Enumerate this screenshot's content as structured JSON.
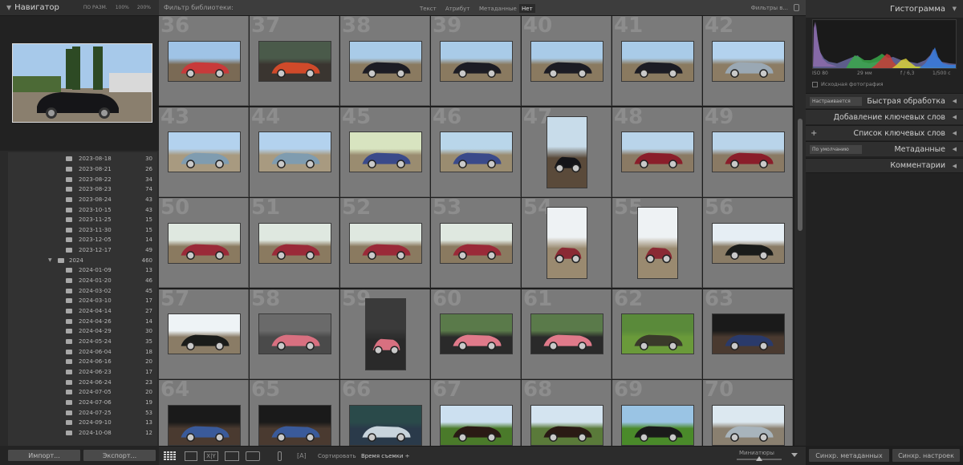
{
  "navigator": {
    "title": "Навигатор",
    "zoom_options": [
      "ПО РАЗМ.",
      "100%",
      "200%"
    ]
  },
  "folders": [
    {
      "name": "2023-08-18",
      "count": "30"
    },
    {
      "name": "2023-08-21",
      "count": "26"
    },
    {
      "name": "2023-08-22",
      "count": "34"
    },
    {
      "name": "2023-08-23",
      "count": "74"
    },
    {
      "name": "2023-08-24",
      "count": "43"
    },
    {
      "name": "2023-10-15",
      "count": "43"
    },
    {
      "name": "2023-11-25",
      "count": "15"
    },
    {
      "name": "2023-11-30",
      "count": "15"
    },
    {
      "name": "2023-12-05",
      "count": "14"
    },
    {
      "name": "2023-12-17",
      "count": "49"
    },
    {
      "name": "2024",
      "count": "460",
      "year": true
    },
    {
      "name": "2024-01-09",
      "count": "13"
    },
    {
      "name": "2024-01-20",
      "count": "46"
    },
    {
      "name": "2024-03-02",
      "count": "45"
    },
    {
      "name": "2024-03-10",
      "count": "17"
    },
    {
      "name": "2024-04-14",
      "count": "27"
    },
    {
      "name": "2024-04-26",
      "count": "14"
    },
    {
      "name": "2024-04-29",
      "count": "30"
    },
    {
      "name": "2024-05-24",
      "count": "35"
    },
    {
      "name": "2024-06-04",
      "count": "18"
    },
    {
      "name": "2024-06-16",
      "count": "20"
    },
    {
      "name": "2024-06-23",
      "count": "17"
    },
    {
      "name": "2024-06-24",
      "count": "23"
    },
    {
      "name": "2024-07-05",
      "count": "20"
    },
    {
      "name": "2024-07-06",
      "count": "19"
    },
    {
      "name": "2024-07-25",
      "count": "53"
    },
    {
      "name": "2024-09-10",
      "count": "13"
    },
    {
      "name": "2024-10-08",
      "count": "12"
    }
  ],
  "left_buttons": {
    "import": "Импорт...",
    "export": "Экспорт..."
  },
  "filter_bar": {
    "title": "Фильтр библиотеки:",
    "tabs": [
      "Текст",
      "Атрибут",
      "Метаданные",
      "Нет"
    ],
    "selected_tab": "Нет",
    "filters_label": "Фильтры в..."
  },
  "grid": {
    "numbers": [
      36,
      37,
      38,
      39,
      40,
      41,
      42,
      43,
      44,
      45,
      46,
      47,
      48,
      49,
      50,
      51,
      52,
      53,
      54,
      55,
      56,
      57,
      58,
      59,
      60,
      61,
      62,
      63,
      64,
      65,
      66,
      67,
      68,
      69,
      70
    ],
    "photos": [
      {
        "orient": "l",
        "color": "#c83a3a",
        "sky": "#9fc3e6",
        "ground": "#7a6a55"
      },
      {
        "orient": "l",
        "color": "#d04a2a",
        "sky": "#4a5a4a",
        "ground": "#3a3530"
      },
      {
        "orient": "l",
        "color": "#1c1c24",
        "sky": "#a9cbe8",
        "ground": "#8a7a60"
      },
      {
        "orient": "l",
        "color": "#1c1c24",
        "sky": "#a9cbe8",
        "ground": "#8a7a60"
      },
      {
        "orient": "l",
        "color": "#1c1c24",
        "sky": "#a9cbe8",
        "ground": "#8a7a60"
      },
      {
        "orient": "l",
        "color": "#1c1c24",
        "sky": "#a9cbe8",
        "ground": "#8a7a60"
      },
      {
        "orient": "l",
        "color": "#9aa8b4",
        "sky": "#b3d2ee",
        "ground": "#8c7c64"
      },
      {
        "orient": "l",
        "color": "#7f9cb0",
        "sky": "#b3d2ee",
        "ground": "#a89a80"
      },
      {
        "orient": "l",
        "color": "#7f9cb0",
        "sky": "#b3d2ee",
        "ground": "#a89a80"
      },
      {
        "orient": "l",
        "color": "#3a4a8a",
        "sky": "#d8e4c0",
        "ground": "#9a8c70"
      },
      {
        "orient": "l",
        "color": "#3a4a8a",
        "sky": "#b9d6ea",
        "ground": "#9a8c70"
      },
      {
        "orient": "p",
        "color": "#141418",
        "sky": "#c8dcea",
        "ground": "#5a4a3a"
      },
      {
        "orient": "l",
        "color": "#8a1e2a",
        "sky": "#b9d4ea",
        "ground": "#8a7a64"
      },
      {
        "orient": "l",
        "color": "#8a1e2a",
        "sky": "#b9d4ea",
        "ground": "#8a7a64"
      },
      {
        "orient": "l",
        "color": "#9a2a38",
        "sky": "#dfe8e0",
        "ground": "#8a7a60"
      },
      {
        "orient": "l",
        "color": "#9a2a38",
        "sky": "#dfe8e0",
        "ground": "#8a7a60"
      },
      {
        "orient": "l",
        "color": "#9a2a38",
        "sky": "#dfe8e0",
        "ground": "#8a7a60"
      },
      {
        "orient": "l",
        "color": "#9a2a38",
        "sky": "#dfe8e0",
        "ground": "#8a7a60"
      },
      {
        "orient": "p",
        "color": "#8a2a34",
        "sky": "#eef2f4",
        "ground": "#9a8a70"
      },
      {
        "orient": "p",
        "color": "#8a2a34",
        "sky": "#eef2f4",
        "ground": "#9a8a70"
      },
      {
        "orient": "l",
        "color": "#1a1c1a",
        "sky": "#e6eef4",
        "ground": "#8a7c66"
      },
      {
        "orient": "l",
        "color": "#1a1c1a",
        "sky": "#eef3f6",
        "ground": "#8a7c66"
      },
      {
        "orient": "l",
        "color": "#d87080",
        "sky": "#6a6a6a",
        "ground": "#4a4a4a"
      },
      {
        "orient": "p",
        "color": "#d87080",
        "sky": "#3a3a3a",
        "ground": "#2a2a2a"
      },
      {
        "orient": "l",
        "color": "#e07a8a",
        "sky": "#5a7a4a",
        "ground": "#2a2a2a"
      },
      {
        "orient": "l",
        "color": "#e07a8a",
        "sky": "#5a7a4a",
        "ground": "#2a2a2a"
      },
      {
        "orient": "l",
        "color": "#3a3a2a",
        "sky": "#5a8a3a",
        "ground": "#6a9a3a"
      },
      {
        "orient": "l",
        "color": "#2a3a6a",
        "sky": "#1a1a1a",
        "ground": "#4a3a30"
      },
      {
        "orient": "l",
        "color": "#3a5a9a",
        "sky": "#1a1a1a",
        "ground": "#4a3a30"
      },
      {
        "orient": "l",
        "color": "#3a5a9a",
        "sky": "#1a1a1a",
        "ground": "#4a3a30"
      },
      {
        "orient": "l",
        "color": "#c8d4dc",
        "sky": "#2a4a4a",
        "ground": "#2a3a4a"
      },
      {
        "orient": "l",
        "color": "#2a1a14",
        "sky": "#cce0f0",
        "ground": "#4a7a2a"
      },
      {
        "orient": "l",
        "color": "#2a1a14",
        "sky": "#d4e4f0",
        "ground": "#5a7a3a"
      },
      {
        "orient": "l",
        "color": "#1a1a1a",
        "sky": "#9ac4e4",
        "ground": "#4a8a2a"
      },
      {
        "orient": "l",
        "color": "#a8b4bc",
        "sky": "#dce8f0",
        "ground": "#8a8070"
      }
    ]
  },
  "toolbar": {
    "sort_label": "Сортировать",
    "sort_value": "Время съемки ÷",
    "thumbnails_label": "Миниатюры"
  },
  "histogram": {
    "title": "Гистограмма",
    "iso": "ISO 80",
    "focal": "29 мм",
    "aperture": "f / 6,3",
    "shutter": "1/500 с",
    "original_photo": "Исходная фотография"
  },
  "right_sections": [
    {
      "label": "Быстрая обработка",
      "control": "Настраивается"
    },
    {
      "label": "Добавление ключевых слов"
    },
    {
      "label": "Список ключевых слов",
      "plus": true
    },
    {
      "label": "Метаданные",
      "control": "По умолчанию"
    },
    {
      "label": "Комментарии"
    }
  ],
  "right_buttons": {
    "sync_meta": "Синхр. метаданных",
    "sync_settings": "Синхр. настроек"
  },
  "colors": {
    "accent_tab_bg": "#2a2a2a",
    "grid_cell": "#7a7a7a",
    "panel_bg": "#2a2a2a"
  }
}
